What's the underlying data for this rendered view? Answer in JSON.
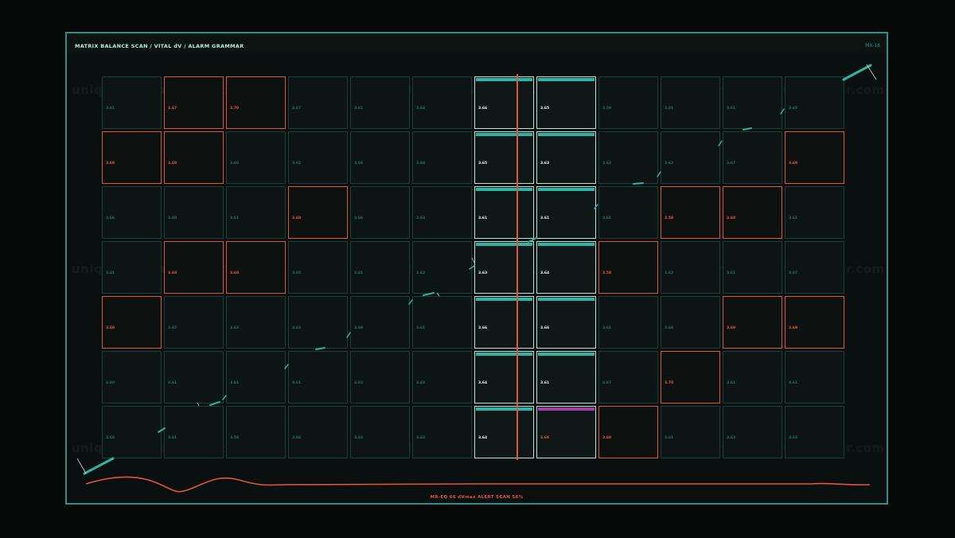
{
  "header": {
    "title": "MATRIX BALANCE SCAN  /  VITAL dV  /  ALARM GRAMMAR",
    "code": "MX-18"
  },
  "footer": {
    "status": "MR-EQ 66   dVmax ALERT   SCAN 56%"
  },
  "watermark": "uniquelivewallpaper.com",
  "colors": {
    "background": "#050807",
    "panel_border": "#2f8f88",
    "alarm": "#e2543f",
    "active": "#2fb3a2",
    "anomaly": "#a33ea3"
  },
  "scan": {
    "progress_percent": 56
  },
  "grid": {
    "rows": [
      {
        "cells": [
          {
            "v": "3.61",
            "s": "n"
          },
          {
            "v": "3.67",
            "s": "a"
          },
          {
            "v": "3.70",
            "s": "a"
          },
          {
            "v": "3.67",
            "s": "n"
          },
          {
            "v": "3.61",
            "s": "n"
          },
          {
            "v": "3.64",
            "s": "n"
          },
          {
            "v": "3.66",
            "s": "h"
          },
          {
            "v": "3.65",
            "s": "h"
          },
          {
            "v": "3.59",
            "s": "n"
          },
          {
            "v": "3.61",
            "s": "n"
          },
          {
            "v": "3.61",
            "s": "n"
          },
          {
            "v": "3.65",
            "s": "n"
          }
        ]
      },
      {
        "cells": [
          {
            "v": "3.69",
            "s": "a"
          },
          {
            "v": "3.69",
            "s": "a"
          },
          {
            "v": "3.66",
            "s": "n"
          },
          {
            "v": "3.62",
            "s": "n"
          },
          {
            "v": "3.66",
            "s": "n"
          },
          {
            "v": "3.64",
            "s": "n"
          },
          {
            "v": "3.65",
            "s": "h"
          },
          {
            "v": "3.63",
            "s": "h"
          },
          {
            "v": "3.62",
            "s": "n"
          },
          {
            "v": "3.62",
            "s": "n"
          },
          {
            "v": "3.67",
            "s": "n"
          },
          {
            "v": "3.69",
            "s": "a"
          }
        ]
      },
      {
        "cells": [
          {
            "v": "3.66",
            "s": "n"
          },
          {
            "v": "3.60",
            "s": "n"
          },
          {
            "v": "3.61",
            "s": "n"
          },
          {
            "v": "3.68",
            "s": "a"
          },
          {
            "v": "3.66",
            "s": "n"
          },
          {
            "v": "3.63",
            "s": "n"
          },
          {
            "v": "3.61",
            "s": "h"
          },
          {
            "v": "3.61",
            "s": "h"
          },
          {
            "v": "3.61",
            "s": "n"
          },
          {
            "v": "3.58",
            "s": "a"
          },
          {
            "v": "3.68",
            "s": "a"
          },
          {
            "v": "3.61",
            "s": "n"
          }
        ]
      },
      {
        "cells": [
          {
            "v": "3.61",
            "s": "n"
          },
          {
            "v": "3.68",
            "s": "a"
          },
          {
            "v": "3.68",
            "s": "a"
          },
          {
            "v": "3.65",
            "s": "n"
          },
          {
            "v": "3.61",
            "s": "n"
          },
          {
            "v": "3.62",
            "s": "n"
          },
          {
            "v": "3.63",
            "s": "h"
          },
          {
            "v": "3.64",
            "s": "h"
          },
          {
            "v": "3.58",
            "s": "a"
          },
          {
            "v": "3.62",
            "s": "n"
          },
          {
            "v": "3.61",
            "s": "n"
          },
          {
            "v": "3.67",
            "s": "n"
          }
        ]
      },
      {
        "cells": [
          {
            "v": "3.69",
            "s": "a"
          },
          {
            "v": "3.65",
            "s": "n"
          },
          {
            "v": "3.62",
            "s": "n"
          },
          {
            "v": "3.63",
            "s": "n"
          },
          {
            "v": "3.69",
            "s": "n"
          },
          {
            "v": "3.61",
            "s": "n"
          },
          {
            "v": "3.66",
            "s": "h"
          },
          {
            "v": "3.66",
            "s": "h"
          },
          {
            "v": "3.61",
            "s": "n"
          },
          {
            "v": "3.66",
            "s": "n"
          },
          {
            "v": "3.69",
            "s": "a"
          },
          {
            "v": "3.69",
            "s": "a"
          }
        ]
      },
      {
        "cells": [
          {
            "v": "3.60",
            "s": "n"
          },
          {
            "v": "3.61",
            "s": "n"
          },
          {
            "v": "3.61",
            "s": "n"
          },
          {
            "v": "3.61",
            "s": "n"
          },
          {
            "v": "3.63",
            "s": "n"
          },
          {
            "v": "3.63",
            "s": "n"
          },
          {
            "v": "3.64",
            "s": "h"
          },
          {
            "v": "3.61",
            "s": "h"
          },
          {
            "v": "3.67",
            "s": "n"
          },
          {
            "v": "3.70",
            "s": "a"
          },
          {
            "v": "3.61",
            "s": "n"
          },
          {
            "v": "3.61",
            "s": "n"
          }
        ]
      },
      {
        "cells": [
          {
            "v": "3.66",
            "s": "n"
          },
          {
            "v": "3.61",
            "s": "n"
          },
          {
            "v": "3.58",
            "s": "n"
          },
          {
            "v": "3.66",
            "s": "n"
          },
          {
            "v": "3.63",
            "s": "n"
          },
          {
            "v": "3.63",
            "s": "n"
          },
          {
            "v": "3.64",
            "s": "h"
          },
          {
            "v": "3.69",
            "s": "hp"
          },
          {
            "v": "3.69",
            "s": "a"
          },
          {
            "v": "3.61",
            "s": "n"
          },
          {
            "v": "3.63",
            "s": "n"
          },
          {
            "v": "3.63",
            "s": "n"
          }
        ]
      }
    ]
  }
}
